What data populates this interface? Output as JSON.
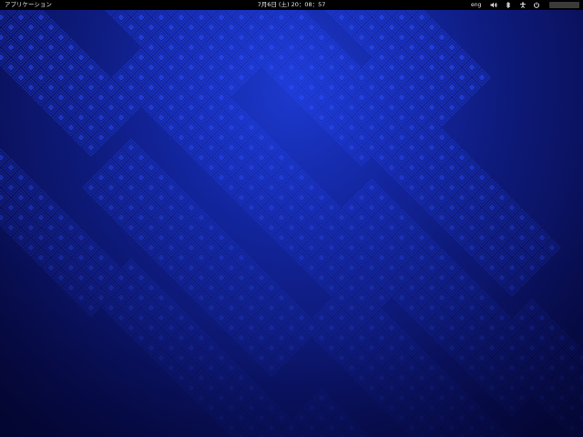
{
  "top_bar": {
    "applications_label": "アプリケーション",
    "clock": "7月6日 (土) 20：08：57",
    "keyboard_layout": "eng"
  },
  "icons": [
    "volume-icon",
    "bluetooth-icon",
    "accessibility-icon",
    "power-icon"
  ],
  "colors": {
    "panel": "#000000",
    "wallpaper_center": "#1d3ad0",
    "wallpaper_edge": "#080c44",
    "tile": "#2a4cff"
  }
}
